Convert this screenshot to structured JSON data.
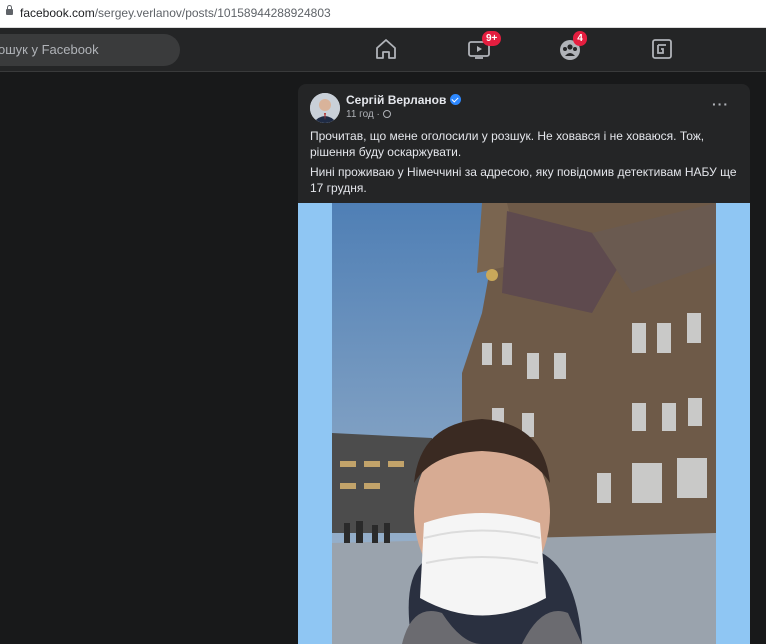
{
  "browser": {
    "url_domain": "facebook.com",
    "url_path": "/sergey.verlanov/posts/10158944288924803"
  },
  "topnav": {
    "search_placeholder": "ошук у Facebook",
    "icons": [
      "home-icon",
      "watch-icon",
      "groups-icon",
      "gaming-icon"
    ],
    "watch_badge": "9+",
    "groups_badge": "4"
  },
  "post": {
    "author": "Сергій Верланов",
    "verified": true,
    "time": "11 год · ",
    "more": "···",
    "paragraph1": "Прочитав, що мене оголосили у розшук. Не ховався і не ховаюся. Тож, рішення буду оскаржувати.",
    "paragraph2": "Нині проживаю у Німеччині за адресою, яку повідомив детективам НАБУ ще 17 грудня."
  },
  "colors": {
    "background": "#18191a",
    "card": "#242526",
    "text": "#e4e6eb",
    "secondary_text": "#b0b3b8",
    "badge": "#e41e3f",
    "verified": "#2d88ff",
    "photo_padding": "#8fc6f3"
  }
}
